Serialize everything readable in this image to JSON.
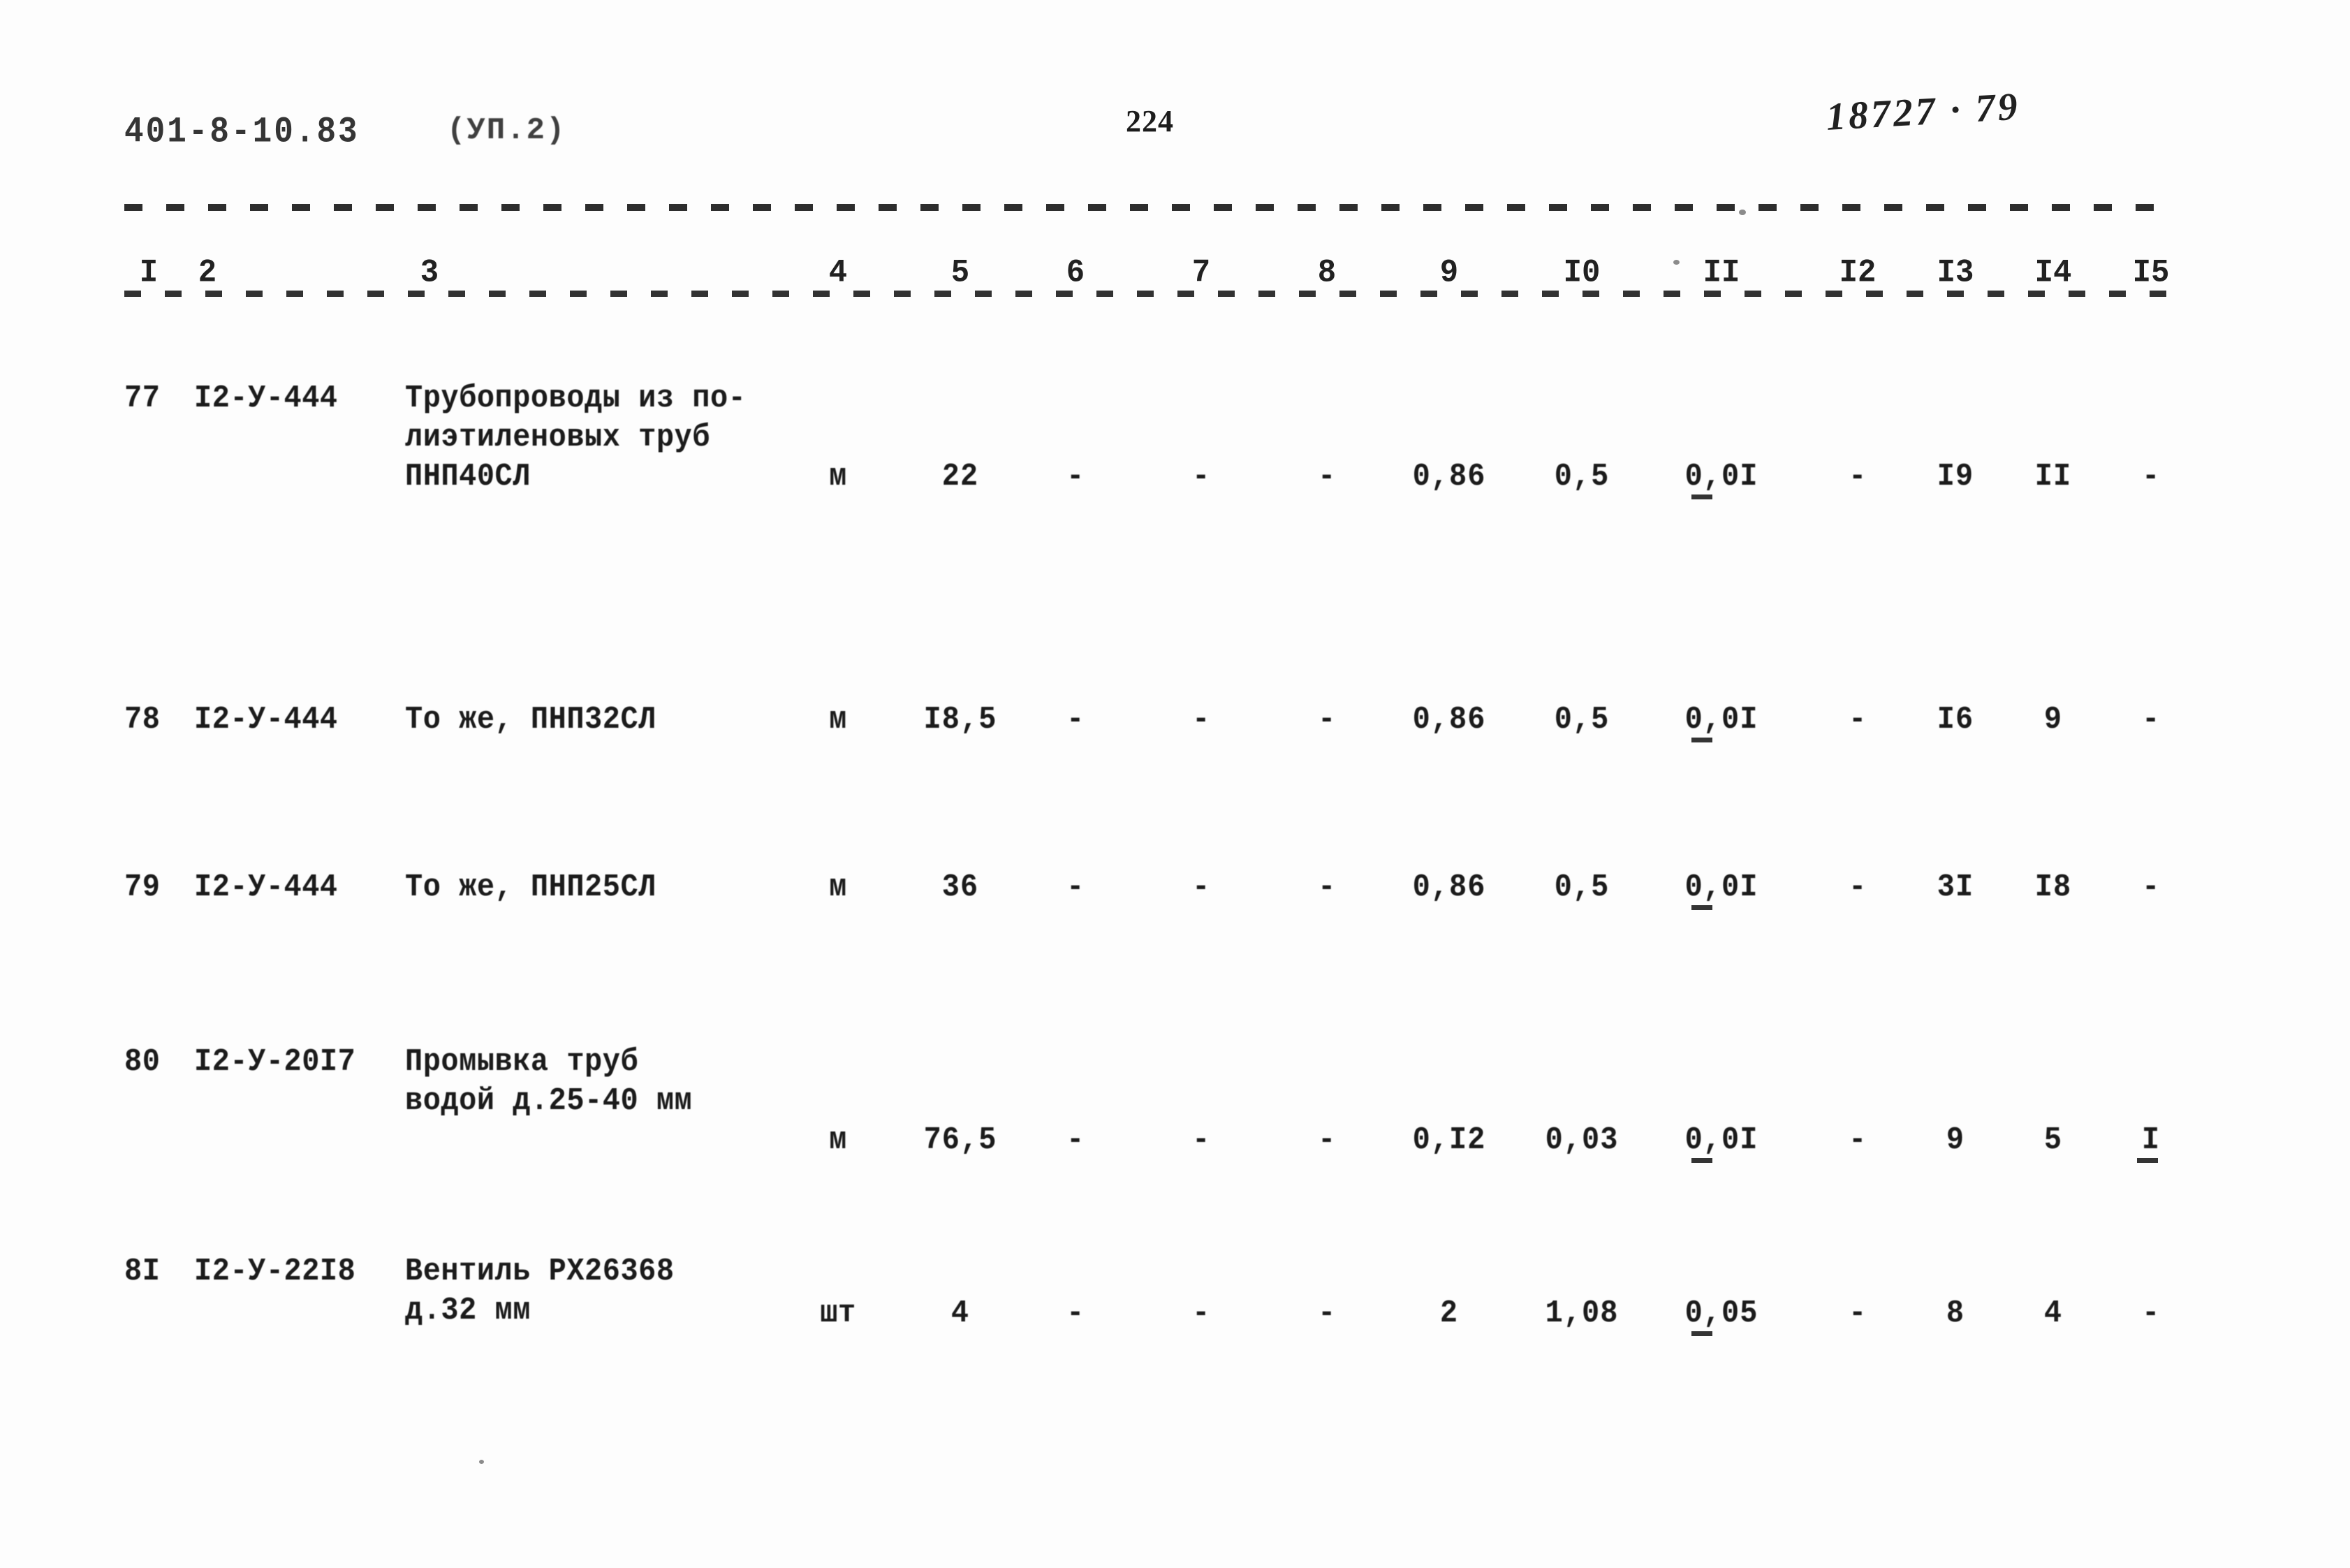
{
  "page": {
    "header_left": "401-8-10.83",
    "header_paren": "(УП.2)",
    "page_number": "224",
    "header_handwritten": "18727 · 79"
  },
  "table": {
    "column_numbers": [
      "I",
      "2",
      "3",
      "4",
      "5",
      "6",
      "7",
      "8",
      "9",
      "I0",
      "II",
      "I2",
      "I3",
      "I4",
      "I5"
    ],
    "rows": [
      {
        "no": "77",
        "code": "I2-У-444",
        "name_lines": [
          "Трубопроводы из по-",
          "лиэтиленовых труб",
          "ПНП40СЛ"
        ],
        "unit": "м",
        "c5": "22",
        "c6": "-",
        "c7": "-",
        "c8": "-",
        "c9": "0,86",
        "c10": "0,5",
        "c11": "0,0I",
        "c12": "-",
        "c13": "I9",
        "c14": "II",
        "c15": "-"
      },
      {
        "no": "78",
        "code": "I2-У-444",
        "name_lines": [
          "То же, ПНП32СЛ"
        ],
        "unit": "м",
        "c5": "I8,5",
        "c6": "-",
        "c7": "-",
        "c8": "-",
        "c9": "0,86",
        "c10": "0,5",
        "c11": "0,0I",
        "c12": "-",
        "c13": "I6",
        "c14": "9",
        "c15": "-"
      },
      {
        "no": "79",
        "code": "I2-У-444",
        "name_lines": [
          "То же, ПНП25СЛ"
        ],
        "unit": "м",
        "c5": "36",
        "c6": "-",
        "c7": "-",
        "c8": "-",
        "c9": "0,86",
        "c10": "0,5",
        "c11": "0,0I",
        "c12": "-",
        "c13": "3I",
        "c14": "I8",
        "c15": "-"
      },
      {
        "no": "80",
        "code": "I2-У-20I7",
        "name_lines": [
          "Промывка труб",
          "водой д.25-40 мм"
        ],
        "unit": "м",
        "c5": "76,5",
        "c6": "-",
        "c7": "-",
        "c8": "-",
        "c9": "0,I2",
        "c10": "0,03",
        "c11": "0,0I",
        "c12": "-",
        "c13": "9",
        "c14": "5",
        "c15": "I"
      },
      {
        "no": "8I",
        "code": "I2-У-22I8",
        "name_lines": [
          "Вентиль РX26368",
          "д.32 мм"
        ],
        "unit": "шт",
        "c5": "4",
        "c6": "-",
        "c7": "-",
        "c8": "-",
        "c9": "2",
        "c10": "1,08",
        "c11": "0,05",
        "c12": "-",
        "c13": "8",
        "c14": "4",
        "c15": "-"
      }
    ]
  }
}
